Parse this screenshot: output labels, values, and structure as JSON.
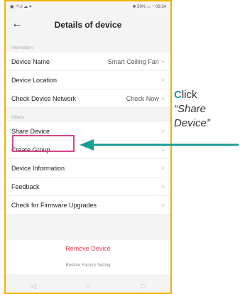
{
  "statusbar": {
    "left": "▣ ⁴ᴳ.ıl ☁ ♥",
    "right": "✱ 59% ▭ ⁺ 08:34"
  },
  "header": {
    "title": "Details of device"
  },
  "sections": {
    "information": "Information",
    "others": "Others"
  },
  "rows": {
    "device_name": {
      "label": "Device Name",
      "value": "Smart Ceiling Fan"
    },
    "device_location": {
      "label": "Device Location"
    },
    "check_network": {
      "label": "Check Device Network",
      "value": "Check Now"
    },
    "share_device": {
      "label": "Share Device"
    },
    "create_group": {
      "label": "Create Group"
    },
    "device_information": {
      "label": "Device Information"
    },
    "feedback": {
      "label": "Feedback"
    },
    "firmware": {
      "label": "Check for Firmware Upgrades"
    }
  },
  "actions": {
    "remove": "Remove Device",
    "restore": "Restore Factory Setting"
  },
  "callout": {
    "accent": "C",
    "word": "lick",
    "line2": "“Share",
    "line3": "Device”"
  },
  "icons": {
    "back": "back-arrow-icon",
    "chevron": "chevron-right-icon"
  },
  "colors": {
    "frame": "#f0b400",
    "highlight": "#d4458c",
    "arrow": "#1a9c96",
    "remove": "#e0414f"
  }
}
